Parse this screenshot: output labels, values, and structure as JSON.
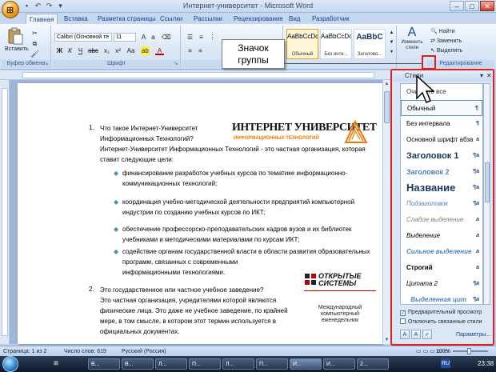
{
  "window": {
    "title": "Интернет-университет - Microsoft Word"
  },
  "ribbon_tabs": [
    "Главная",
    "Вставка",
    "Разметка страницы",
    "Ссылки",
    "Рассылки",
    "Рецензирование",
    "Вид",
    "Разработчик"
  ],
  "ribbon": {
    "paste_label": "Вставить",
    "clipboard_group": "Буфер обмена",
    "font_name": "Calibri (Основной те",
    "font_size": "11",
    "font_group": "Шрифт",
    "styles": [
      {
        "sample": "AaBbCcDc",
        "name": "Обычный"
      },
      {
        "sample": "AaBbCcDc",
        "name": "Без инте..."
      },
      {
        "sample": "AaBbC",
        "name": "Заголово..."
      }
    ],
    "change_styles_label": "Изменить стили",
    "find_label": "Найти",
    "replace_label": "Заменить",
    "select_label": "Выделить",
    "editing_group": "Редактирование"
  },
  "callout": {
    "line1": "Значок",
    "line2": "группы"
  },
  "document": {
    "item1_num": "1.",
    "item1_q1": "Что такое Интернет-Университет",
    "item1_q2": "Информационных Технологий?",
    "item1_a1": "Интернет-Университет Информационных Технологий - это частная организация, которая",
    "item1_a2": "ставит следующие цели:",
    "bullets": [
      [
        "финансирование разработок учебных курсов по тематике информационно-",
        "коммуникационных технологий;"
      ],
      [
        "координация учебно-методической деятельности предприятий компьютерной",
        "индустрии по созданию учебных курсов по ИКТ;"
      ],
      [
        "обеспечение профессорско-преподавательских кадров вузов и их библиотек",
        "учебниками и методическими материалами по курсам ИКТ;"
      ],
      [
        "содействие органам государственной власти в области развития образовательных",
        "программ, связанных с современными",
        "информационными технологиями."
      ]
    ],
    "item2_num": "2.",
    "item2_lines": [
      "Это государственное или частное учебное заведение?",
      "Это частная организация, учредителями которой являются",
      "физические лица. Это даже не учебное заведение, по крайней",
      "мере, в том смысле, в котором этот термин используется в",
      "официальных документах."
    ],
    "logo_iu_title": "ИНТЕРНЕТ УНИВЕРСИТЕТ",
    "logo_iu_sub": "ИНФОРМАЦИОННЫХ ТЕХНОЛОГИЙ",
    "logo_os_line1": "ОТКРЫТЫЕ",
    "logo_os_line2": "СИСТЕМЫ",
    "logo_os_caption1": "Международный",
    "logo_os_caption2": "компьютерный",
    "logo_os_caption3": "еженедельник"
  },
  "styles_pane": {
    "title": "Стили",
    "items": [
      {
        "label": "Очистить все",
        "mark": ""
      },
      {
        "label": "Обычный",
        "mark": "¶"
      },
      {
        "label": "Без интервала",
        "mark": "¶"
      },
      {
        "label": "Основной шрифт абза",
        "mark": "a"
      },
      {
        "label": "Заголовок 1",
        "mark": "¶a"
      },
      {
        "label": "Заголовок 2",
        "mark": "¶a"
      },
      {
        "label": "Название",
        "mark": "¶a"
      },
      {
        "label": "Подзаголовок",
        "mark": "¶a"
      },
      {
        "label": "Слабое выделение",
        "mark": "a"
      },
      {
        "label": "Выделение",
        "mark": "a"
      },
      {
        "label": "Сильное выделение",
        "mark": "a"
      },
      {
        "label": "Строгий",
        "mark": "a"
      },
      {
        "label": "Цитата 2",
        "mark": "¶a"
      },
      {
        "label": "Выделенная цит",
        "mark": "¶a"
      }
    ],
    "preview_label": "Предварительный просмотр",
    "linked_label": "Отключить связанные стили",
    "params_label": "Параметры..."
  },
  "statusbar": {
    "page": "Страница: 1 из 2",
    "words": "Число слов: 619",
    "language": "Русский (Россия)",
    "zoom": "100%"
  },
  "taskbar": {
    "items": [
      "В...",
      "В...",
      "Л...",
      "П...",
      "Л...",
      "П...",
      "И...",
      "И...",
      "2..."
    ],
    "lang": "RU",
    "time": "23:38"
  },
  "colors": {
    "accent_red": "#e02020",
    "ribbon_blue": "#c5d8f0",
    "bullet_teal": "#3a9aa8"
  }
}
